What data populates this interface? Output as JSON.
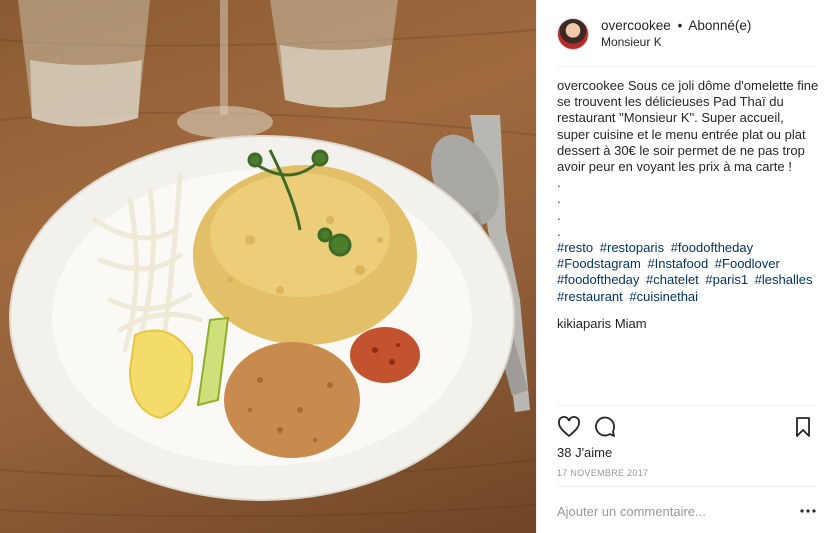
{
  "post": {
    "username": "overcookee",
    "separator": "•",
    "follow_status": "Abonné(e)",
    "location": "Monsieur K",
    "caption": {
      "user": "overcookee",
      "text": "Sous ce joli dôme d'omelette fine se trouvent les délicieuses Pad Thaï du restaurant \"Monsieur K\". Super accueil, super cuisine et le menu entrée plat ou plat dessert à 30€ le soir permet de ne pas trop avoir peur en voyant les prix à ma carte !\n.\n.\n.\n.",
      "hashtags": [
        "#resto",
        "#restoparis",
        "#foodoftheday",
        "#Foodstagram",
        "#Instafood",
        "#Foodlover",
        "#foodoftheday",
        "#chatelet",
        "#paris1",
        "#leshalles",
        "#restaurant",
        "#cuisinethai"
      ]
    },
    "comments": [
      {
        "user": "kikiaparis",
        "text": "Miam"
      }
    ],
    "likes": "38 J'aime",
    "date": "17 NOVEMBRE 2017",
    "comment_placeholder": "Ajouter un commentaire...",
    "icons": {
      "like": "heart-icon",
      "comment": "comment-icon",
      "save": "bookmark-icon",
      "options": "more-options-icon"
    }
  },
  "colors": {
    "hashtag": "#003569",
    "muted": "#999999",
    "text": "#262626",
    "divider": "#efefef"
  }
}
